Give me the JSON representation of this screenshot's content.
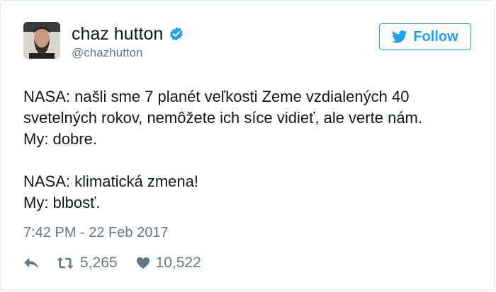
{
  "user": {
    "display_name": "chaz hutton",
    "handle": "@chazhutton",
    "verified": true
  },
  "follow": {
    "label": "Follow"
  },
  "tweet": {
    "lines": [
      "NASA: našli sme 7 planét veľkosti Zeme vzdialených 40 svetelných rokov, nemôžete ich síce vidieť, ale verte nám.",
      "My: dobre.",
      "NASA: klimatická zmena!",
      "My: blbosť."
    ],
    "timestamp": "7:42 PM - 22 Feb 2017"
  },
  "stats": {
    "retweets": "5,265",
    "likes": "10,522"
  },
  "colors": {
    "accent": "#1da1f2",
    "muted": "#657786",
    "text": "#14171a",
    "border": "#e1e8ed"
  },
  "icons": [
    "verified-icon",
    "twitter-bird-icon",
    "reply-icon",
    "retweet-icon",
    "heart-icon"
  ]
}
